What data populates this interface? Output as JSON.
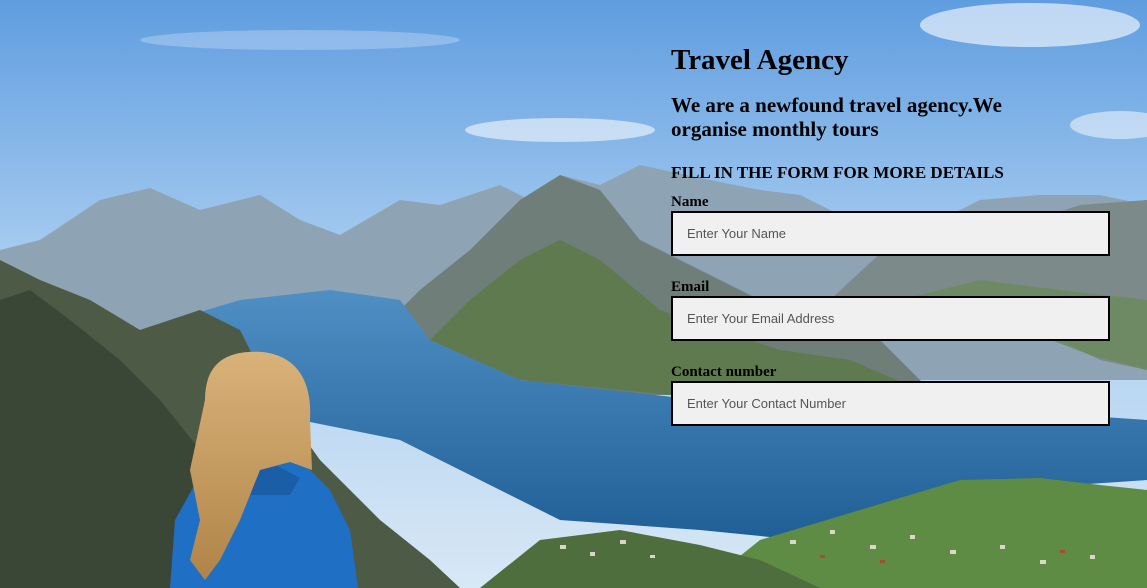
{
  "header": {
    "title": "Travel Agency",
    "subtitle": "We are a newfound travel agency.We organise monthly tours",
    "form_heading": "FILL IN THE FORM FOR MORE DETAILS"
  },
  "form": {
    "name_label": "Name",
    "name_placeholder": "Enter Your Name",
    "email_label": "Email",
    "email_placeholder": "Enter Your Email Address",
    "contact_label": "Contact number",
    "contact_placeholder": "Enter Your Contact Number"
  },
  "background": {
    "scene": "fjord-mountains-hiker",
    "sky_color": "#7fb4e6",
    "water_color": "#2a6fa8",
    "jacket_color": "#1f6fc4"
  }
}
